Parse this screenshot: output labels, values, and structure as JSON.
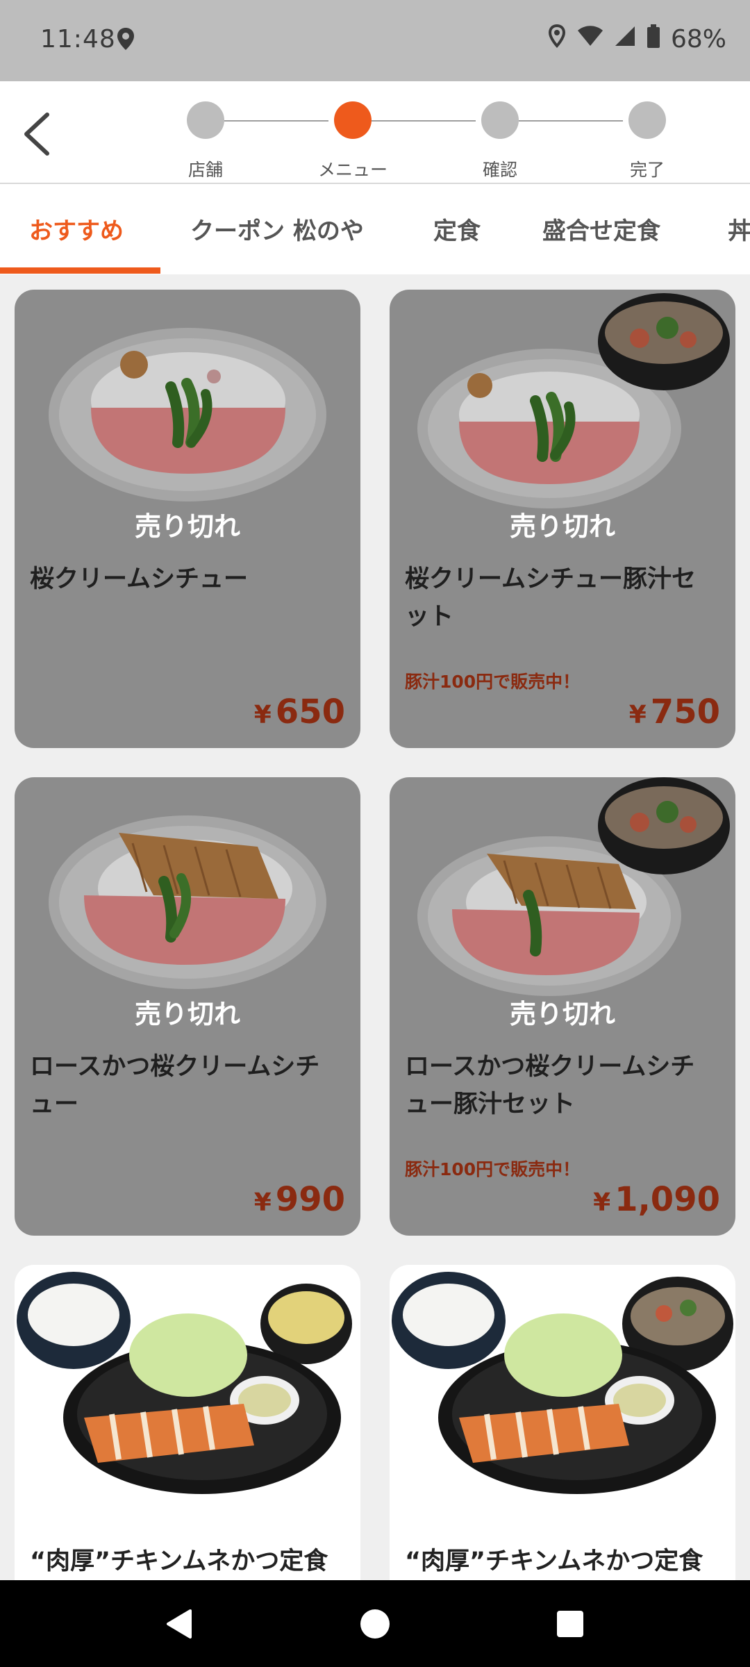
{
  "status": {
    "time": "11:48",
    "battery": "68%"
  },
  "steps": [
    {
      "label": "店舗",
      "active": false
    },
    {
      "label": "メニュー",
      "active": true
    },
    {
      "label": "確認",
      "active": false
    },
    {
      "label": "完了",
      "active": false
    }
  ],
  "tabs": [
    {
      "label": "おすすめ",
      "active": true
    },
    {
      "label": "クーポン 松のや",
      "active": false
    },
    {
      "label": "定食",
      "active": false
    },
    {
      "label": "盛合せ定食",
      "active": false
    },
    {
      "label": "丼",
      "active": false
    }
  ],
  "sold_out_label": "売り切れ",
  "items": [
    {
      "title": "桜クリームシチュー",
      "promo": "",
      "price": "650",
      "sold_out": true,
      "image": "sakura-cream-stew-icon"
    },
    {
      "title": "桜クリームシチュー豚汁セット",
      "promo": "豚汁100円で販売中！",
      "price": "750",
      "sold_out": true,
      "image": "sakura-cream-stew-tonjiru-icon"
    },
    {
      "title": "ロースかつ桜クリームシチュー",
      "promo": "",
      "price": "990",
      "sold_out": true,
      "image": "loin-katsu-stew-icon"
    },
    {
      "title": "ロースかつ桜クリームシチュー豚汁セット",
      "promo": "豚汁100円で販売中！",
      "price": "1,090",
      "sold_out": true,
      "image": "loin-katsu-stew-tonjiru-icon"
    },
    {
      "title": "“肉厚”チキンムネかつ定食",
      "promo": "",
      "price": "",
      "sold_out": false,
      "image": "chicken-katsu-set-icon"
    },
    {
      "title": "“肉厚”チキンムネかつ定食",
      "promo": "",
      "price": "",
      "sold_out": false,
      "image": "chicken-katsu-set-tonjiru-icon"
    }
  ],
  "currency": "¥"
}
